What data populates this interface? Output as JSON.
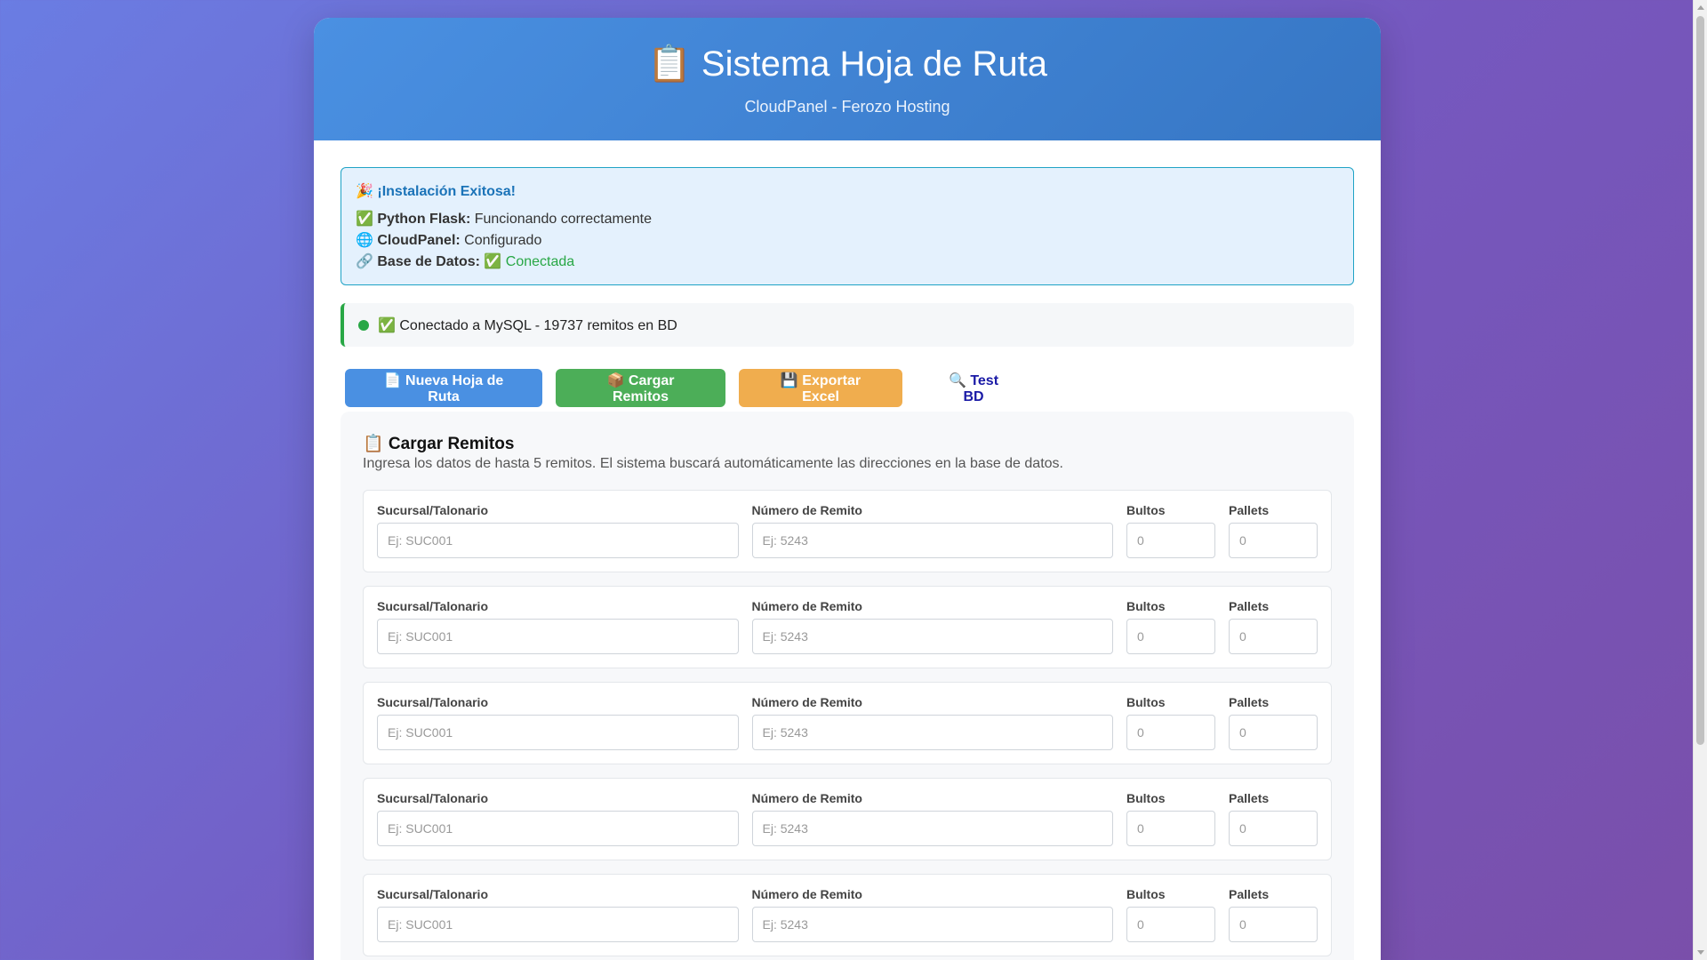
{
  "header": {
    "icon": "📋",
    "title": "Sistema Hoja de Ruta",
    "subtitle": "CloudPanel - Ferozo Hosting"
  },
  "success": {
    "icon": "🎉",
    "title": "¡Instalación Exitosa!",
    "lines": [
      {
        "icon": "✅",
        "label": "Python Flask:",
        "value": "Funcionando correctamente"
      },
      {
        "icon": "🌐",
        "label": "CloudPanel:",
        "value": "Configurado"
      },
      {
        "icon": "🔗",
        "label": "Base de Datos:",
        "value": "✅ Conectada"
      }
    ]
  },
  "status": {
    "text": "✅ Conectado a MySQL - 19737 remitos en BD",
    "color": "#28a745"
  },
  "actions": {
    "nueva": "📄 Nueva Hoja de Ruta",
    "cargar": "📦 Cargar Remitos",
    "exportar": "💾 Exportar Excel",
    "test": "🔍 Test BD"
  },
  "section": {
    "title": "📋 Cargar Remitos",
    "description": "Ingresa los datos de hasta 5 remitos. El sistema buscará automáticamente las direcciones en la base de datos."
  },
  "fields": {
    "sucursal_label": "Sucursal/Talonario",
    "sucursal_placeholder": "Ej: SUC001",
    "numero_label": "Número de Remito",
    "numero_placeholder": "Ej: 5243",
    "bultos_label": "Bultos",
    "bultos_placeholder": "0",
    "pallets_label": "Pallets",
    "pallets_placeholder": "0"
  },
  "colors": {
    "header_blue": "#4a90e2",
    "success_green": "#28a745",
    "button_green": "#4cae58",
    "button_orange": "#f0ad4e",
    "link_blue": "#1a1aa6"
  }
}
